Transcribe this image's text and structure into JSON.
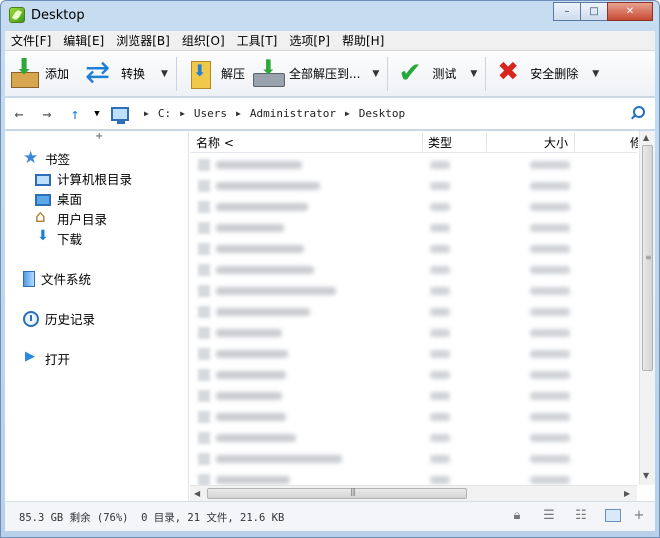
{
  "window": {
    "title": "Desktop",
    "minimize_label": "–",
    "maximize_label": "□",
    "close_label": "✕"
  },
  "menu": [
    "文件[F]",
    "编辑[E]",
    "浏览器[B]",
    "组织[O]",
    "工具[T]",
    "选项[P]",
    "帮助[H]"
  ],
  "toolbar": {
    "add": "添加",
    "convert": "转换",
    "extract": "解压",
    "extract_all": "全部解压到...",
    "test": "测试",
    "delete": "安全删除"
  },
  "address": {
    "drive": "C:",
    "crumbs": [
      "Users",
      "Administrator",
      "Desktop"
    ]
  },
  "sidebar": {
    "bookmarks": "书签",
    "items": [
      "计算机根目录",
      "桌面",
      "用户目录",
      "下载"
    ],
    "filesystem": "文件系统",
    "history": "历史记录",
    "open": "打开"
  },
  "filelist": {
    "columns": {
      "name": "名称 <",
      "type": "类型",
      "size": "大小",
      "more": "修"
    }
  },
  "status": {
    "text": "85.3 GB 剩余 (76%)  0 目录, 21 文件, 21.6 KB"
  },
  "colors": {
    "accent": "#1e7fd6",
    "title_bg": "#c7dcf1"
  }
}
